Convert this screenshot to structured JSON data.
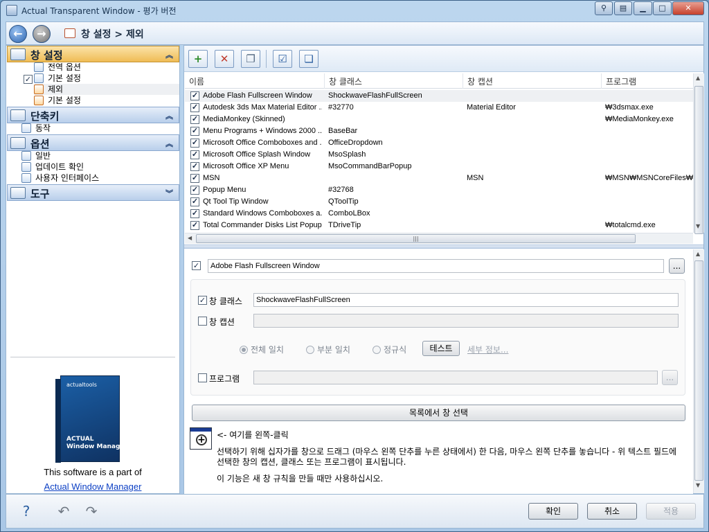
{
  "window": {
    "title": "Actual Transparent Window - 평가 버전"
  },
  "nav": {
    "breadcrumb": "창 설정 > 제외"
  },
  "sidebar": {
    "sections": [
      {
        "title": "창 설정",
        "items": [
          "전역 옵션",
          "기본 설정",
          "제외",
          "기본 설정"
        ]
      },
      {
        "title": "단축키",
        "items": [
          "동작"
        ]
      },
      {
        "title": "옵션",
        "items": [
          "일반",
          "업데이트 확인",
          "사용자 인터페이스"
        ]
      },
      {
        "title": "도구",
        "items": []
      }
    ],
    "promo": {
      "box_brand": "actualtools",
      "box_title": "ACTUAL\nWindow Manager",
      "text": "This software is a part of",
      "link": "Actual Window Manager"
    }
  },
  "grid": {
    "columns": [
      "이름",
      "창 클래스",
      "창 캡션",
      "프로그램"
    ],
    "rows": [
      {
        "name": "Adobe Flash Fullscreen Window",
        "cls": "ShockwaveFlashFullScreen",
        "caption": "",
        "program": "",
        "checked": true
      },
      {
        "name": "Autodesk 3ds Max Material Editor ...",
        "cls": "#32770",
        "caption": "Material Editor",
        "program": "₩3dsmax.exe",
        "checked": true
      },
      {
        "name": "MediaMonkey (Skinned)",
        "cls": "",
        "caption": "",
        "program": "₩MediaMonkey.exe",
        "checked": true
      },
      {
        "name": "Menu Programs + Windows 2000 ...",
        "cls": "BaseBar",
        "caption": "",
        "program": "",
        "checked": true
      },
      {
        "name": "Microsoft Office Comboboxes and ...",
        "cls": "OfficeDropdown",
        "caption": "",
        "program": "",
        "checked": true
      },
      {
        "name": "Microsoft Office Splash Window",
        "cls": "MsoSplash",
        "caption": "",
        "program": "",
        "checked": true
      },
      {
        "name": "Microsoft Office XP Menu",
        "cls": "MsoCommandBarPopup",
        "caption": "",
        "program": "",
        "checked": true
      },
      {
        "name": "MSN",
        "cls": "",
        "caption": "MSN",
        "program": "₩MSN₩MSNCoreFiles₩",
        "checked": true
      },
      {
        "name": "Popup Menu",
        "cls": "#32768",
        "caption": "",
        "program": "",
        "checked": true
      },
      {
        "name": "Qt Tool Tip Window",
        "cls": "QToolTip",
        "caption": "",
        "program": "",
        "checked": true
      },
      {
        "name": "Standard Windows Comboboxes a...",
        "cls": "ComboLBox",
        "caption": "",
        "program": "",
        "checked": true
      },
      {
        "name": "Total Commander Disks List Popup",
        "cls": "TDriveTip",
        "caption": "",
        "program": "₩totalcmd.exe",
        "checked": true
      }
    ]
  },
  "detail": {
    "name_value": "Adobe Flash Fullscreen Window",
    "browse": "...",
    "class_label": "창 클래스",
    "class_value": "ShockwaveFlashFullScreen",
    "caption_label": "창 캡션",
    "caption_value": "",
    "match_options": [
      "전체 일치",
      "부분 일치",
      "정규식"
    ],
    "test_button": "테스트",
    "details_link": "세부 정보...",
    "program_label": "프로그램",
    "program_value": "",
    "select_button": "목록에서 창 선택",
    "left_click_hint": "<- 여기를 왼쪽-클릭",
    "instructions": "선택하기 위해 십자가를 창으로 드래그 (마우스 왼쪽 단추를 누른 상태에서) 한 다음, 마우스 왼쪽 단추를 놓습니다 - 위 텍스트 필드에 선택한 창의 캡션, 클래스 또는 프로그램이 표시됩니다.",
    "note": "이 기능은 새 창 규칙을 만들 때만 사용하십시오."
  },
  "footer": {
    "ok": "확인",
    "cancel": "취소",
    "apply": "적용"
  }
}
